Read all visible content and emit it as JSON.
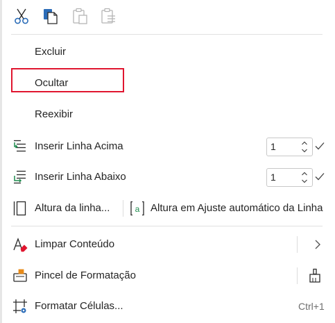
{
  "toolbar": {
    "icons": [
      "scissors-icon",
      "copy-icon",
      "paste-icon",
      "paste-special-icon"
    ],
    "accent": "#2b6cb8"
  },
  "menu": {
    "items": [
      {
        "label": "Excluir"
      },
      {
        "label": "Ocultar"
      },
      {
        "label": "Reexibir"
      },
      {
        "label": "Inserir Linha Acima",
        "value": "1"
      },
      {
        "label": "Inserir Linha Abaixo",
        "value": "1"
      },
      {
        "label": "Altura da linha...",
        "secondary_label": "Altura em Ajuste automático da Linha"
      },
      {
        "label": "Limpar Conteúdo"
      },
      {
        "label": "Pincel de Formatação"
      },
      {
        "label": "Formatar Células...",
        "shortcut": "Ctrl+1"
      }
    ]
  },
  "colors": {
    "highlight": "#e0152f",
    "text": "#242424",
    "muted": "#6e6e6e",
    "green": "#1e8c4e",
    "blue": "#2b6cb8"
  }
}
